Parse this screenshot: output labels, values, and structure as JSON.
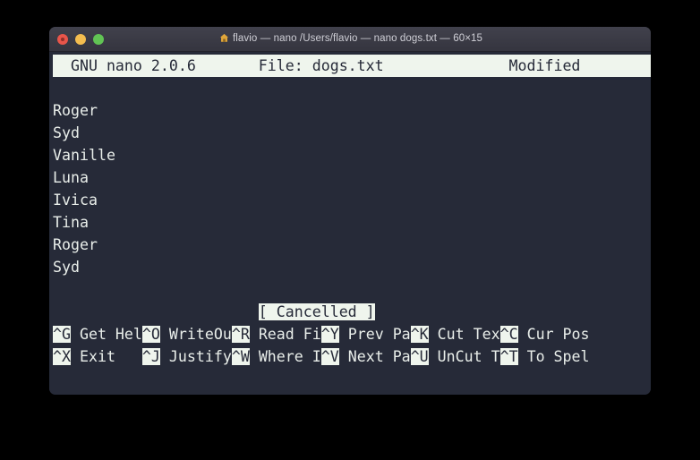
{
  "window": {
    "title": "flavio — nano /Users/flavio — nano dogs.txt — 60×15",
    "home_icon": "home-icon",
    "cols": 60,
    "rows": 15,
    "colors": {
      "desktop_bg": "#000000",
      "titlebar_bg": "#3a3a44",
      "terminal_bg": "#262a38",
      "terminal_fg": "#e9eeea",
      "inverse_bg": "#eff5ed",
      "inverse_fg": "#262a38",
      "close": "#e8554a",
      "minimize": "#f4bd4f",
      "zoom": "#61c454"
    },
    "buttons": {
      "close": "close-button",
      "minimize": "minimize-button",
      "zoom": "zoom-button"
    }
  },
  "editor": {
    "statusbar": {
      "left": "GNU nano 2.0.6",
      "center": "File: dogs.txt",
      "right": "Modified"
    },
    "lines": [
      "Roger",
      "Syd",
      "Vanille",
      "Luna",
      "Ivica",
      "Tina",
      "Roger",
      "Syd"
    ],
    "message": "[ Cancelled ]",
    "shortcuts_row1": [
      {
        "key": "^G",
        "label": "Get Hel"
      },
      {
        "key": "^O",
        "label": "WriteOu"
      },
      {
        "key": "^R",
        "label": "Read Fi"
      },
      {
        "key": "^Y",
        "label": "Prev Pa"
      },
      {
        "key": "^K",
        "label": "Cut Tex"
      },
      {
        "key": "^C",
        "label": "Cur Pos"
      }
    ],
    "shortcuts_row2": [
      {
        "key": "^X",
        "label": "Exit   "
      },
      {
        "key": "^J",
        "label": "Justify"
      },
      {
        "key": "^W",
        "label": "Where I"
      },
      {
        "key": "^V",
        "label": "Next Pa"
      },
      {
        "key": "^U",
        "label": "UnCut T"
      },
      {
        "key": "^T",
        "label": "To Spel"
      }
    ]
  }
}
